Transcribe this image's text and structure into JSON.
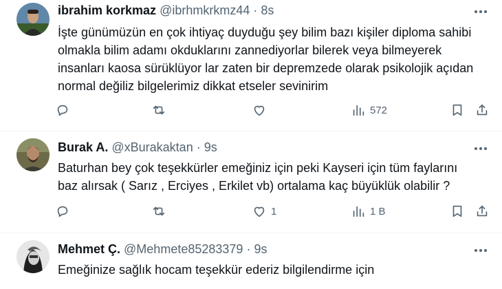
{
  "tweets": [
    {
      "name": "ibrahim korkmaz",
      "handle": "@ibrhmkrkmz44",
      "separator": "·",
      "time": "8s",
      "text": "İşte günümüzün en çok ihtiyaç duyduğu şey bilim bazı kişiler diploma sahibi\nolmakla bilim adamı okduklarını zannediyorlar bilerek veya bilmeyerek\ninsanları kaosa sürüklüyor lar zaten bir depremzede olarak psikolojik açıdan\nnormal değiliz bilgelerimiz dikkat etseler sevinirim",
      "replies": "",
      "retweets": "",
      "likes": "",
      "views": "572"
    },
    {
      "name": "Burak A.",
      "handle": "@xBurakaktan",
      "separator": "·",
      "time": "9s",
      "text": "Baturhan bey çok teşekkürler emeğiniz için peki Kayseri için tüm faylarını\nbaz alırsak  ( Sarız , Erciyes , Erkilet vb) ortalama kaç büyüklük olabilir ?",
      "replies": "",
      "retweets": "",
      "likes": "1",
      "views": "1 B"
    },
    {
      "name": "Mehmet Ç.",
      "handle": "@Mehmete85283379",
      "separator": "·",
      "time": "9s",
      "text": "Emeğinize sağlık hocam teşekkür ederiz bilgilendirme için"
    }
  ],
  "icons": {
    "reply": "reply-icon",
    "retweet": "retweet-icon",
    "like": "heart-icon",
    "views": "views-icon",
    "bookmark": "bookmark-icon",
    "share": "share-icon",
    "more": "more-icon"
  },
  "colors": {
    "text": "#0f1419",
    "secondary": "#536471",
    "divider": "#eff3f4"
  }
}
